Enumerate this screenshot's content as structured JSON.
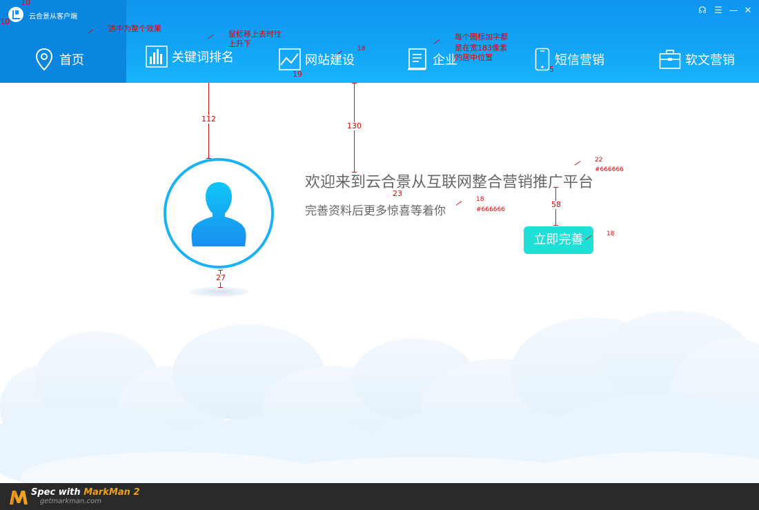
{
  "app": {
    "title": "云合景从客户端"
  },
  "window_controls": [
    {
      "icon": "headset-icon",
      "glyph": "☊"
    },
    {
      "icon": "menu-icon",
      "glyph": "☰"
    },
    {
      "icon": "minimize-icon",
      "glyph": "—"
    },
    {
      "icon": "close-icon",
      "glyph": "✕"
    }
  ],
  "nav": [
    {
      "label": "首页",
      "icon": "location-pin-icon",
      "active": true
    },
    {
      "label": "关键词排名",
      "icon": "bar-chart-icon",
      "active": false
    },
    {
      "label": "网站建设",
      "icon": "line-chart-icon",
      "active": false
    },
    {
      "label": "企业",
      "icon": "document-icon",
      "active": false
    },
    {
      "label": "短信营销",
      "icon": "phone-icon",
      "active": false
    },
    {
      "label": "软文营销",
      "icon": "briefcase-icon",
      "active": false
    }
  ],
  "main": {
    "welcome": "欢迎来到云合景从互联网整合营销推广平台",
    "subtext": "完善资料后更多惊喜等着你",
    "button": "立即完善"
  },
  "annotations": {
    "logo_top": "10",
    "logo_left": "10",
    "active_note": "选中为整个效果",
    "hover_note_1": "鼠标移上去时往",
    "hover_note_2": "上升下",
    "icon_size": "18",
    "icon_gap": "19",
    "width_note_1": "每个图标加字都",
    "width_note_2": "是在宽183像素",
    "width_note_3": "的居中位置",
    "icon_text_gap": "5",
    "avatar_top": "112",
    "title_top": "130",
    "title_size": "22",
    "title_color": "#666666",
    "line_gap": "23",
    "sub_size": "18",
    "sub_color": "#666666",
    "btn_gap": "58",
    "btn_size": "18",
    "avatar_bottom": "27"
  },
  "footer": {
    "spec_prefix": "Spec with ",
    "brand": "MarkMan 2",
    "url": "getmarkman.com"
  },
  "colors": {
    "header": "#12a3f5",
    "active": "#0a86df",
    "button": "#1ee0d7",
    "text": "#666666",
    "annotation": "#e00000"
  }
}
